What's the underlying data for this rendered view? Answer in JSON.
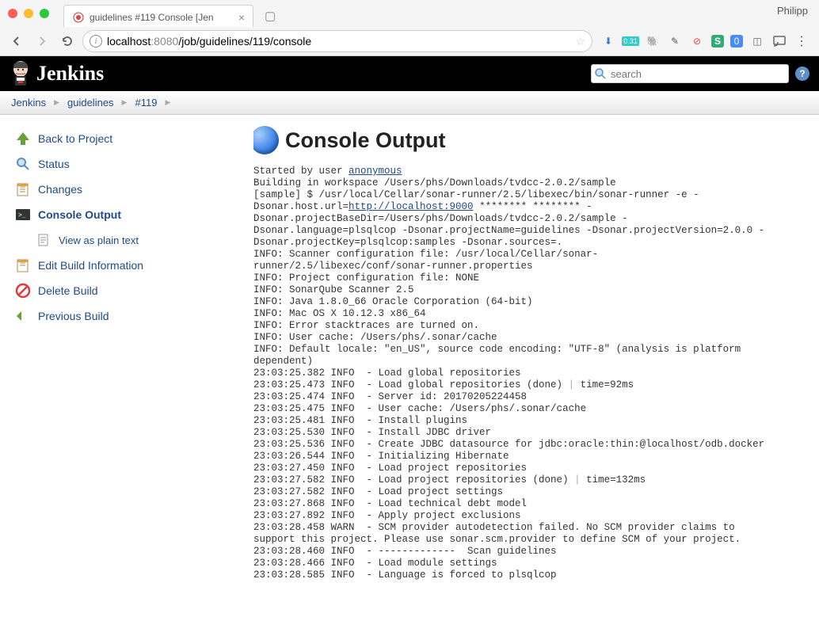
{
  "browser": {
    "profile_name": "Philipp",
    "tab_title": "guidelines #119 Console [Jen",
    "url_host": "localhost",
    "url_port": ":8080",
    "url_path": "/job/guidelines/119/console"
  },
  "header": {
    "title": "Jenkins",
    "search_placeholder": "search"
  },
  "breadcrumbs": {
    "root": "Jenkins",
    "project": "guidelines",
    "build": "#119"
  },
  "sidebar": {
    "back": "Back to Project",
    "status": "Status",
    "changes": "Changes",
    "console": "Console Output",
    "plain": "View as plain text",
    "edit": "Edit Build Information",
    "delete": "Delete Build",
    "previous": "Previous Build"
  },
  "main": {
    "title": "Console Output",
    "started_prefix": "Started by user ",
    "started_user": "anonymous",
    "line2": "Building in workspace /Users/phs/Downloads/tvdcc-2.0.2/sample",
    "line3": "[sample] $ /usr/local/Cellar/sonar-runner/2.5/libexec/bin/sonar-runner -e -",
    "line4_pre": "Dsonar.host.url=",
    "line4_url": "http://localhost:9000",
    "line4_post": " ******** ******** -",
    "line5": "Dsonar.projectBaseDir=/Users/phs/Downloads/tvdcc-2.0.2/sample -",
    "line6": "Dsonar.language=plsqlcop -Dsonar.projectName=guidelines -Dsonar.projectVersion=2.0.0 -",
    "line7": "Dsonar.projectKey=plsqlcop:samples -Dsonar.sources=.",
    "line8": "INFO: Scanner configuration file: /usr/local/Cellar/sonar-",
    "line9": "runner/2.5/libexec/conf/sonar-runner.properties",
    "line10": "INFO: Project configuration file: NONE",
    "line11": "INFO: SonarQube Scanner 2.5",
    "line12": "INFO: Java 1.8.0_66 Oracle Corporation (64-bit)",
    "line13": "INFO: Mac OS X 10.12.3 x86_64",
    "line14": "INFO: Error stacktraces are turned on.",
    "line15": "INFO: User cache: /Users/phs/.sonar/cache",
    "line16": "INFO: Default locale: \"en_US\", source code encoding: \"UTF-8\" (analysis is platform",
    "line17": "dependent)",
    "line18": "23:03:25.382 INFO  - Load global repositories",
    "line19a": "23:03:25.473 INFO  - Load global repositories (done) ",
    "line19b": " time=92ms",
    "line20": "23:03:25.474 INFO  - Server id: 20170205224458",
    "line21": "23:03:25.475 INFO  - User cache: /Users/phs/.sonar/cache",
    "line22": "23:03:25.481 INFO  - Install plugins",
    "line23": "23:03:25.530 INFO  - Install JDBC driver",
    "line24": "23:03:25.536 INFO  - Create JDBC datasource for jdbc:oracle:thin:@localhost/odb.docker",
    "line25": "23:03:26.544 INFO  - Initializing Hibernate",
    "line26": "23:03:27.450 INFO  - Load project repositories",
    "line27a": "23:03:27.582 INFO  - Load project repositories (done) ",
    "line27b": " time=132ms",
    "line28": "23:03:27.582 INFO  - Load project settings",
    "line29": "23:03:27.868 INFO  - Load technical debt model",
    "line30": "23:03:27.892 INFO  - Apply project exclusions",
    "line31": "23:03:28.458 WARN  - SCM provider autodetection failed. No SCM provider claims to",
    "line32": "support this project. Please use sonar.scm.provider to define SCM of your project.",
    "line33": "23:03:28.460 INFO  - -------------  Scan guidelines",
    "line34": "23:03:28.466 INFO  - Load module settings",
    "line35": "23:03:28.585 INFO  - Language is forced to plsqlcop"
  }
}
